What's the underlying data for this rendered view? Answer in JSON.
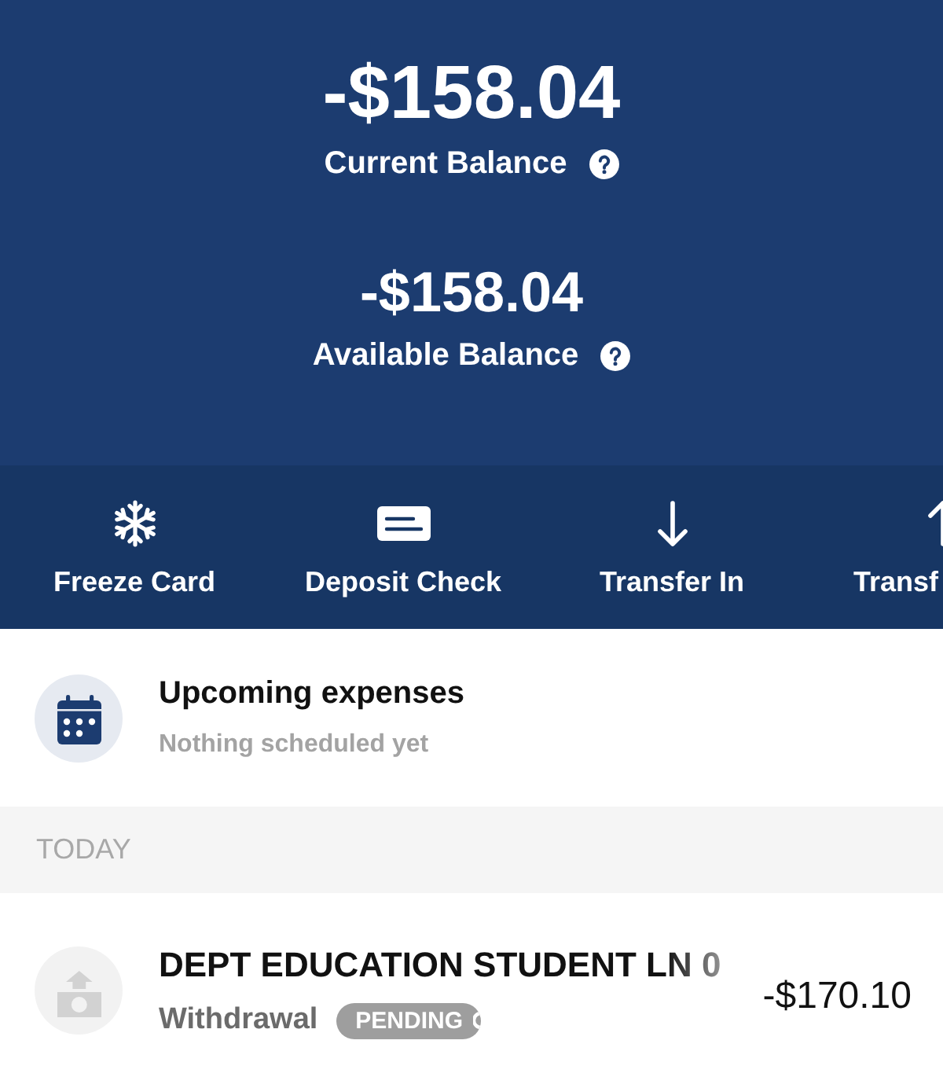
{
  "balances": [
    {
      "amount": "-$158.04",
      "label": "Current Balance"
    },
    {
      "amount": "-$158.04",
      "label": "Available Balance"
    }
  ],
  "actions": [
    {
      "kind": "snowflake",
      "label": "Freeze Card"
    },
    {
      "kind": "card",
      "label": "Deposit Check"
    },
    {
      "kind": "arrow-down",
      "label": "Transfer In"
    },
    {
      "kind": "arrow-up",
      "label": "Transf"
    }
  ],
  "upcoming": {
    "title": "Upcoming expenses",
    "subtitle": "Nothing scheduled yet"
  },
  "sections": [
    {
      "heading": "TODAY",
      "transactions": [
        {
          "kind": "withdrawal",
          "title": "DEPT EDUCATION STUDENT LN 0",
          "type": "Withdrawal",
          "status": "PENDING",
          "amount": "-$170.10"
        }
      ]
    }
  ]
}
